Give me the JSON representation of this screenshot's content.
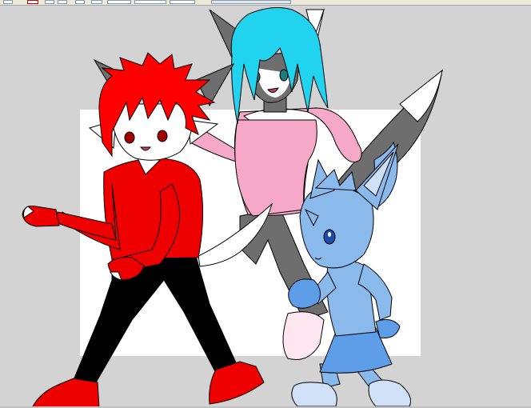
{
  "toolbar": {
    "buttons": [
      {
        "name": "palette-icon"
      },
      {
        "name": "pen-tool-icon"
      },
      {
        "name": "layer-a-icon"
      },
      {
        "name": "layer-b-icon"
      },
      {
        "name": "layer-c-icon"
      },
      {
        "name": "zoom-icon"
      }
    ]
  },
  "canvas": {
    "background": "#d3d3d3",
    "paper": "#ffffff"
  },
  "colors": {
    "red_char_hair": "#ff0000",
    "red_char_shirt": "#ee0000",
    "pants": "#000000",
    "cyan_hair": "#22d3f0",
    "pink_shirt": "#f5a8c8",
    "gray_fur": "#6e6e6e",
    "blue_char": "#8ab9ec",
    "blue_skirt": "#5e9ee8"
  }
}
